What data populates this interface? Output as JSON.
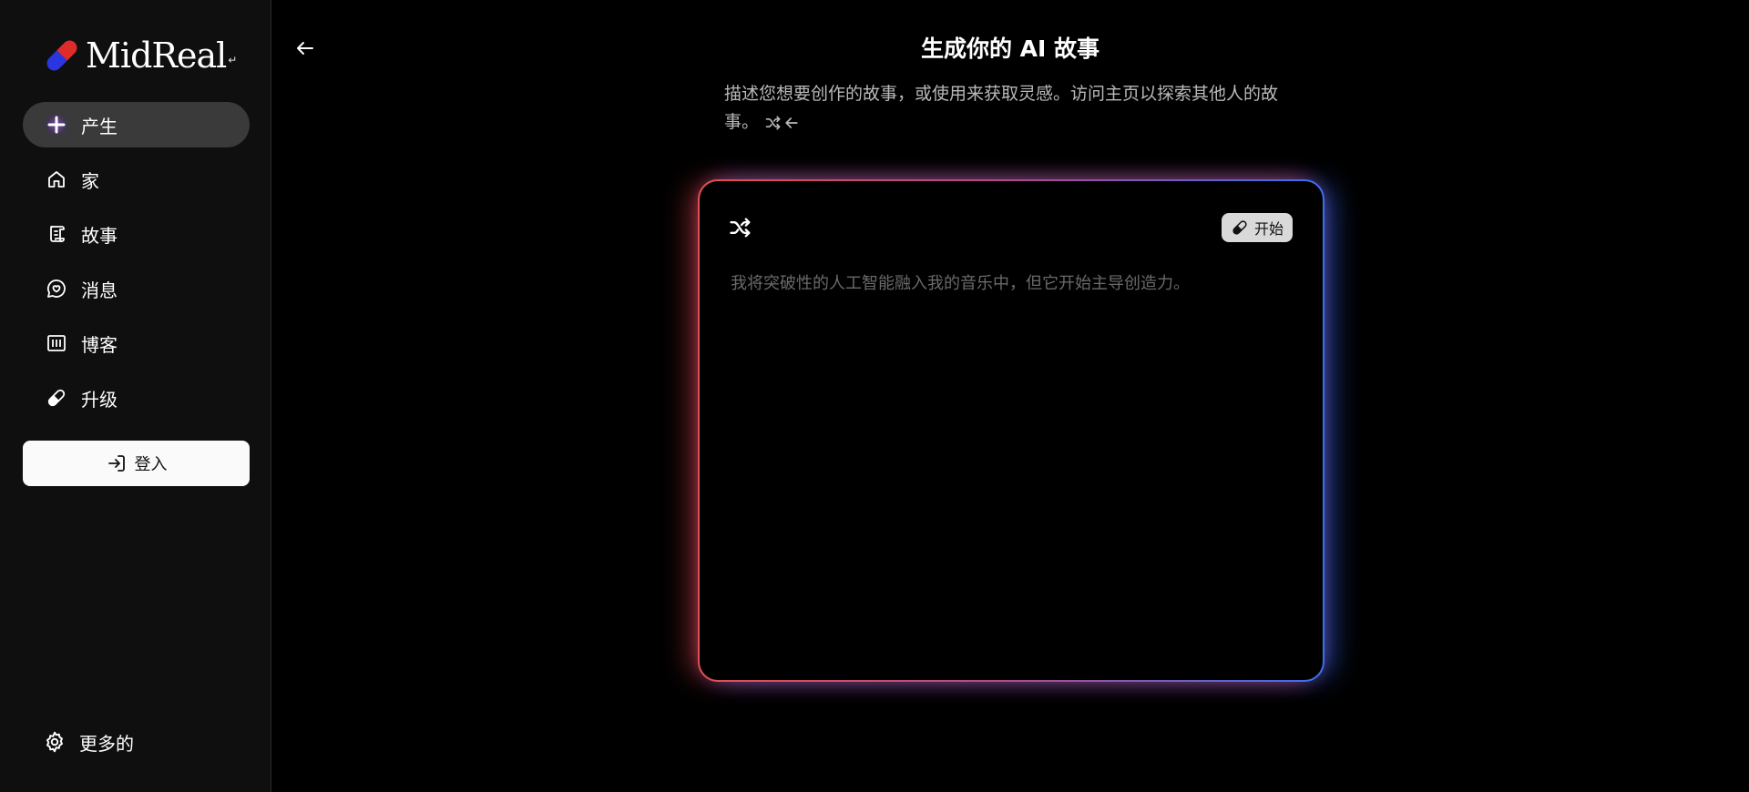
{
  "brand": {
    "name": "MidReal",
    "mark": "↵"
  },
  "sidebar": {
    "items": [
      {
        "label": "产生",
        "icon": "plus-icon",
        "active": true
      },
      {
        "label": "家",
        "icon": "home-icon"
      },
      {
        "label": "故事",
        "icon": "scroll-icon"
      },
      {
        "label": "消息",
        "icon": "message-heart-icon"
      },
      {
        "label": "博客",
        "icon": "library-icon"
      },
      {
        "label": "升级",
        "icon": "pill-icon"
      }
    ],
    "login_label": "登入",
    "settings_label": "更多的"
  },
  "main": {
    "title": "生成你的 AI 故事",
    "description": "描述您想要创作的故事，或使用来获取灵感。访问主页以探索其他人的故事。",
    "card": {
      "start_label": "开始",
      "placeholder": "我将突破性的人工智能融入我的音乐中，但它开始主导创造力。"
    }
  },
  "colors": {
    "accent_red": "#e05050",
    "accent_blue": "#3a6ff0",
    "sidebar_bg": "#0f0f0f",
    "active_bg": "#3a3a3a"
  }
}
